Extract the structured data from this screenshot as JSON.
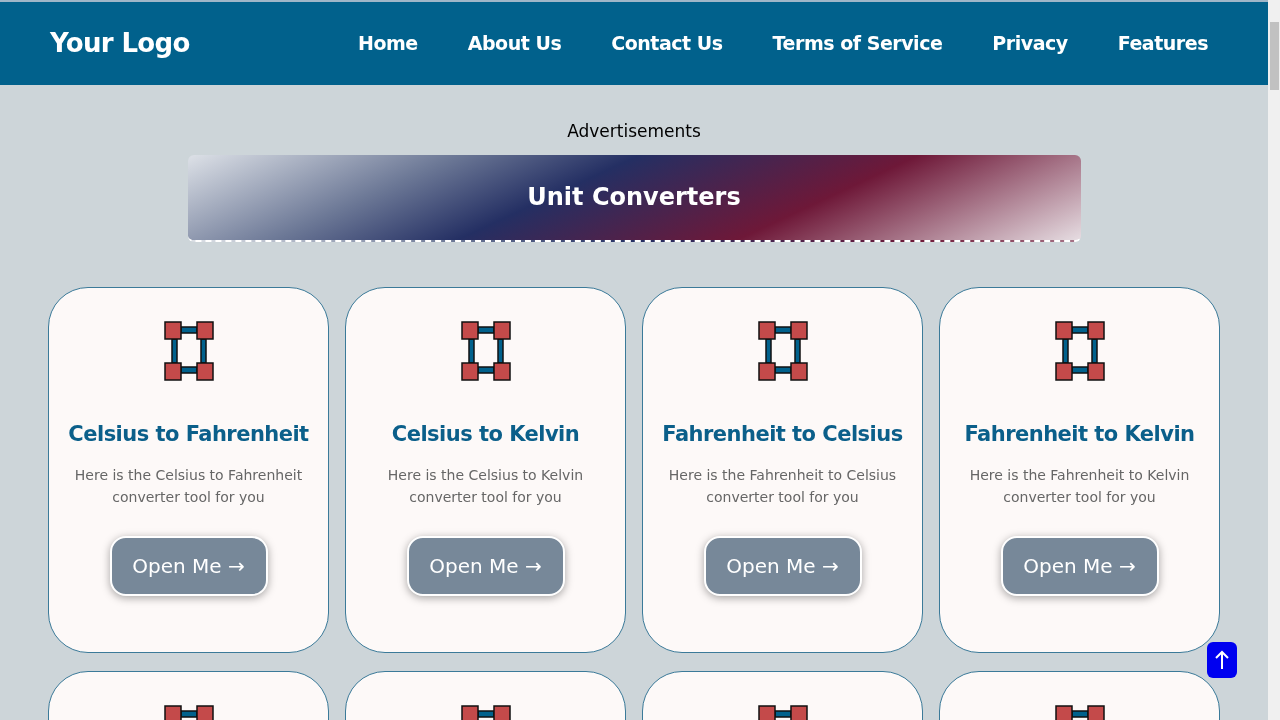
{
  "header": {
    "logo": "Your Logo",
    "nav": [
      {
        "label": "Home"
      },
      {
        "label": "About Us"
      },
      {
        "label": "Contact Us"
      },
      {
        "label": "Terms of Service"
      },
      {
        "label": "Privacy"
      },
      {
        "label": "Features"
      }
    ]
  },
  "ad_label": "Advertisements",
  "banner": {
    "title": "Unit Converters"
  },
  "cards": [
    {
      "kind": "full",
      "title": "Celsius to Fahrenheit",
      "description": "Here is the Celsius to Fahrenheit converter tool for you",
      "button": "Open Me →"
    },
    {
      "kind": "full",
      "title": "Celsius to Kelvin",
      "description": "Here is the Celsius to Kelvin converter tool for you",
      "button": "Open Me →"
    },
    {
      "kind": "full",
      "title": "Fahrenheit to Celsius",
      "description": "Here is the Fahrenheit to Celsius converter tool for you",
      "button": "Open Me →"
    },
    {
      "kind": "full",
      "title": "Fahrenheit to Kelvin",
      "description": "Here is the Fahrenheit to Kelvin converter tool for you",
      "button": "Open Me →"
    },
    {
      "kind": "clipped"
    },
    {
      "kind": "clipped"
    },
    {
      "kind": "clipped"
    },
    {
      "kind": "clipped"
    }
  ]
}
